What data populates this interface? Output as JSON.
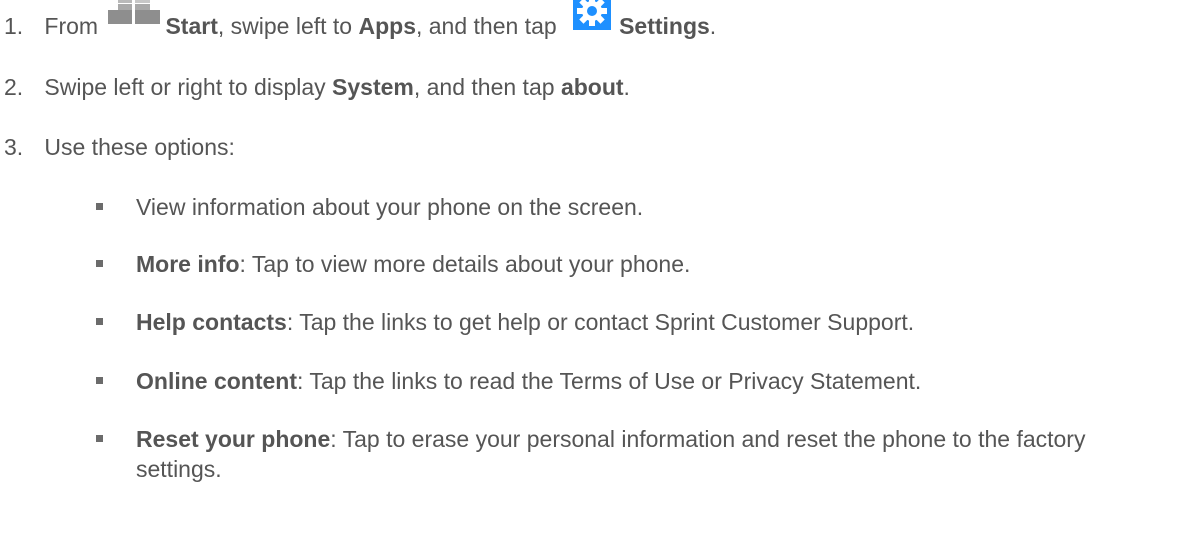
{
  "steps": [
    {
      "num": "1.",
      "parts": {
        "p1": "From",
        "p2": "Start",
        "p3": ", swipe left to ",
        "p4": "Apps",
        "p5": ", and then tap",
        "p6": "Settings",
        "p7": "."
      }
    },
    {
      "num": "2.",
      "parts": {
        "p1": "Swipe left or right to display ",
        "p2": "System",
        "p3": ", and then tap ",
        "p4": "about",
        "p5": "."
      }
    },
    {
      "num": "3.",
      "text": "Use these options:"
    }
  ],
  "options": [
    {
      "text": "View information about your phone on the screen."
    },
    {
      "term": "More info",
      "text": ": Tap to view more details about your phone."
    },
    {
      "term": "Help contacts",
      "text": ": Tap the links to get help or contact Sprint Customer Support."
    },
    {
      "term": "Online content",
      "text": ": Tap the links to read the Terms of Use or Privacy Statement."
    },
    {
      "term": "Reset your phone",
      "text": ": Tap to erase your personal information and reset the phone to the factory settings."
    }
  ],
  "icons": {
    "start": "windows-start-icon",
    "settings": "gear-settings-icon",
    "settings_bg": "#1e90ff",
    "start_color": "#9a9a9a"
  }
}
